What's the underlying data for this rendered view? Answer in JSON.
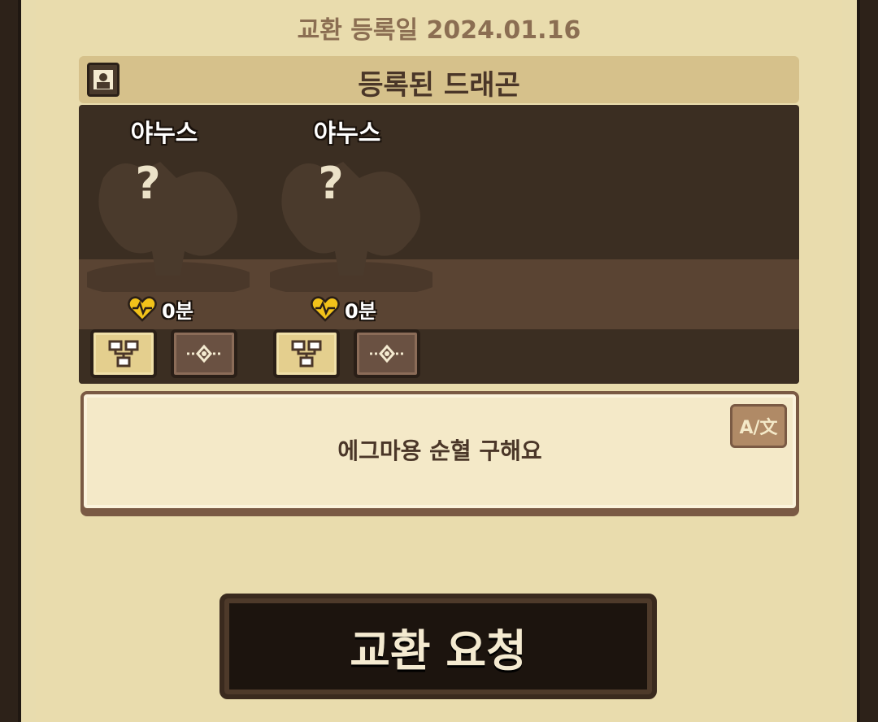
{
  "registration": {
    "label": "교환 등록일 2024.01.16"
  },
  "registered_section": {
    "title": "등록된 드래곤"
  },
  "dragons": [
    {
      "name": "야누스",
      "unknown_mark": "?",
      "affinity": "0분"
    },
    {
      "name": "야누스",
      "unknown_mark": "?",
      "affinity": "0분"
    }
  ],
  "memo": {
    "text": "에그마용 순혈 구해요",
    "translate_label": "A/文"
  },
  "actions": {
    "request_label": "교환 요청"
  },
  "colors": {
    "panel": "#e9dcad",
    "header": "#d6c18b",
    "dark": "#3b2e22",
    "heart": "#f2c21a"
  }
}
